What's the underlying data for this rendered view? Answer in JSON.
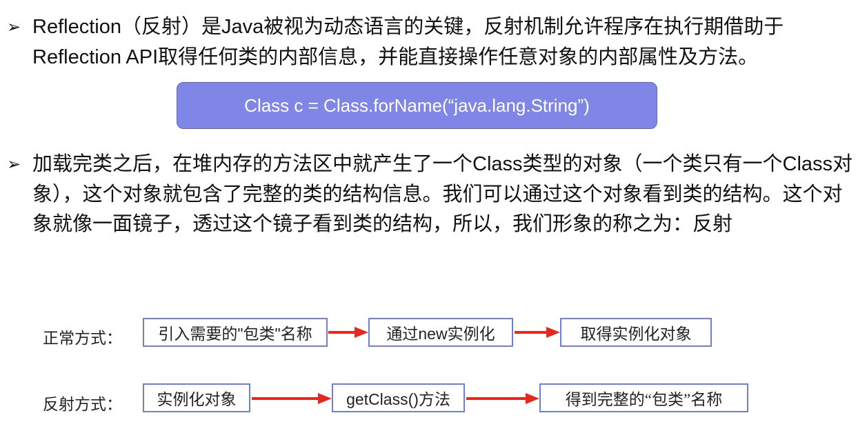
{
  "bullets": [
    {
      "marker": "➢",
      "text": "Reflection（反射）是Java被视为动态语言的关键，反射机制允许程序在执行期借助于Reflection API取得任何类的内部信息，并能直接操作任意对象的内部属性及方法。"
    },
    {
      "marker": "➢",
      "text": "加载完类之后，在堆内存的方法区中就产生了一个Class类型的对象（一个类只有一个Class对象），这个对象就包含了完整的类的结构信息。我们可以通过这个对象看到类的结构。这个对象就像一面镜子，透过这个镜子看到类的结构，所以，我们形象的称之为：反射"
    }
  ],
  "code_box": {
    "text": "Class c = Class.forName(“java.lang.String”)",
    "color": "#7f86e6"
  },
  "normal_way": {
    "label": "正常方式：",
    "steps": [
      "引入需要的\"包类\"名称",
      "通过new实例化",
      "取得实例化对象"
    ]
  },
  "reflection_way": {
    "label": "反射方式：",
    "steps": [
      "实例化对象",
      "getClass()方法",
      "得到完整的“包类”名称"
    ]
  },
  "colors": {
    "arrow": "#e8281e",
    "box_border": "#6c7ed8"
  }
}
